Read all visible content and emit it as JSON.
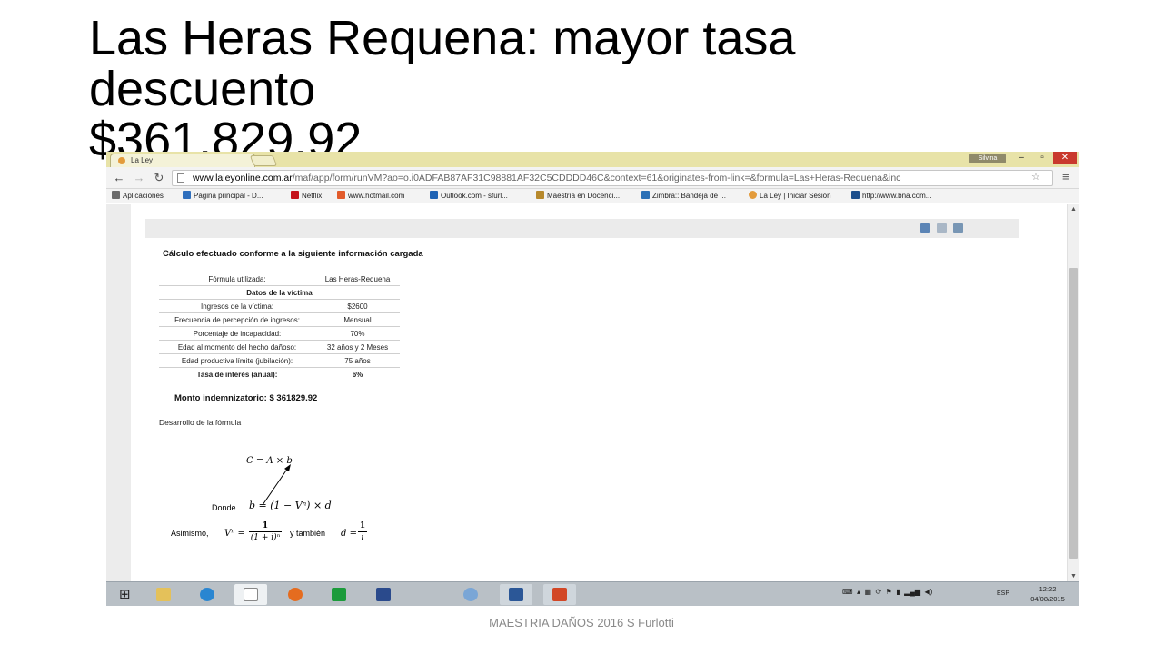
{
  "slide": {
    "title": "Las Heras Requena: mayor tasa\ndescuento\n$361.829,92",
    "footer": "MAESTRIA DAÑOS 2016 S Furlotti"
  },
  "browser": {
    "tab_title": "La Ley",
    "user": "Silvina",
    "url_host": "www.laleyonline.com.ar",
    "url_path": "/maf/app/form/runVM?ao=o.i0ADFAB87AF31C98881AF32C5CDDDD46C&context=61&originates-from-link=&formula=Las+Heras-Requena&inc",
    "bookmarks": [
      "Aplicaciones",
      "Página principal - D...",
      "Netflix",
      "www.hotmail.com",
      "Outlook.com - sfurl...",
      "Maestría en Docenci...",
      "Zimbra:: Bandeja de ...",
      "La Ley | Iniciar Sesión",
      "http://www.bna.com..."
    ]
  },
  "calc": {
    "heading": "Cálculo efectuado conforme a la siguiente información cargada",
    "rows": [
      {
        "label": "Fórmula utilizada:",
        "value": "Las Heras-Requena"
      },
      {
        "label": "Datos de la víctima",
        "value": ""
      },
      {
        "label": "Ingresos de la víctima:",
        "value": "$2600"
      },
      {
        "label": "Frecuencia de percepción de ingresos:",
        "value": "Mensual"
      },
      {
        "label": "Porcentaje de incapacidad:",
        "value": "70%"
      },
      {
        "label": "Edad al momento del hecho dañoso:",
        "value": "32 años y 2 Meses"
      },
      {
        "label": "Edad productiva límite (jubilación):",
        "value": "75 años"
      },
      {
        "label": "Tasa de interés (anual):",
        "value": "6%"
      }
    ],
    "monto": "Monto indemnizatorio: $ 361829.92",
    "desarrollo": "Desarrollo de la fórmula",
    "formula_c": "C = A × b",
    "donde": "Donde",
    "formula_b": "b = (1 − Vⁿ) × d",
    "asimismo": "Asimismo,",
    "v_lhs": "Vⁿ =",
    "frac1_num": "1",
    "frac1_den": "(1 + i)ⁿ",
    "tambien": "y también",
    "d_lhs": "d =",
    "frac2_num": "1",
    "frac2_den": "i"
  },
  "taskbar": {
    "language": "ESP",
    "time": "12:22",
    "date": "04/08/2015"
  }
}
